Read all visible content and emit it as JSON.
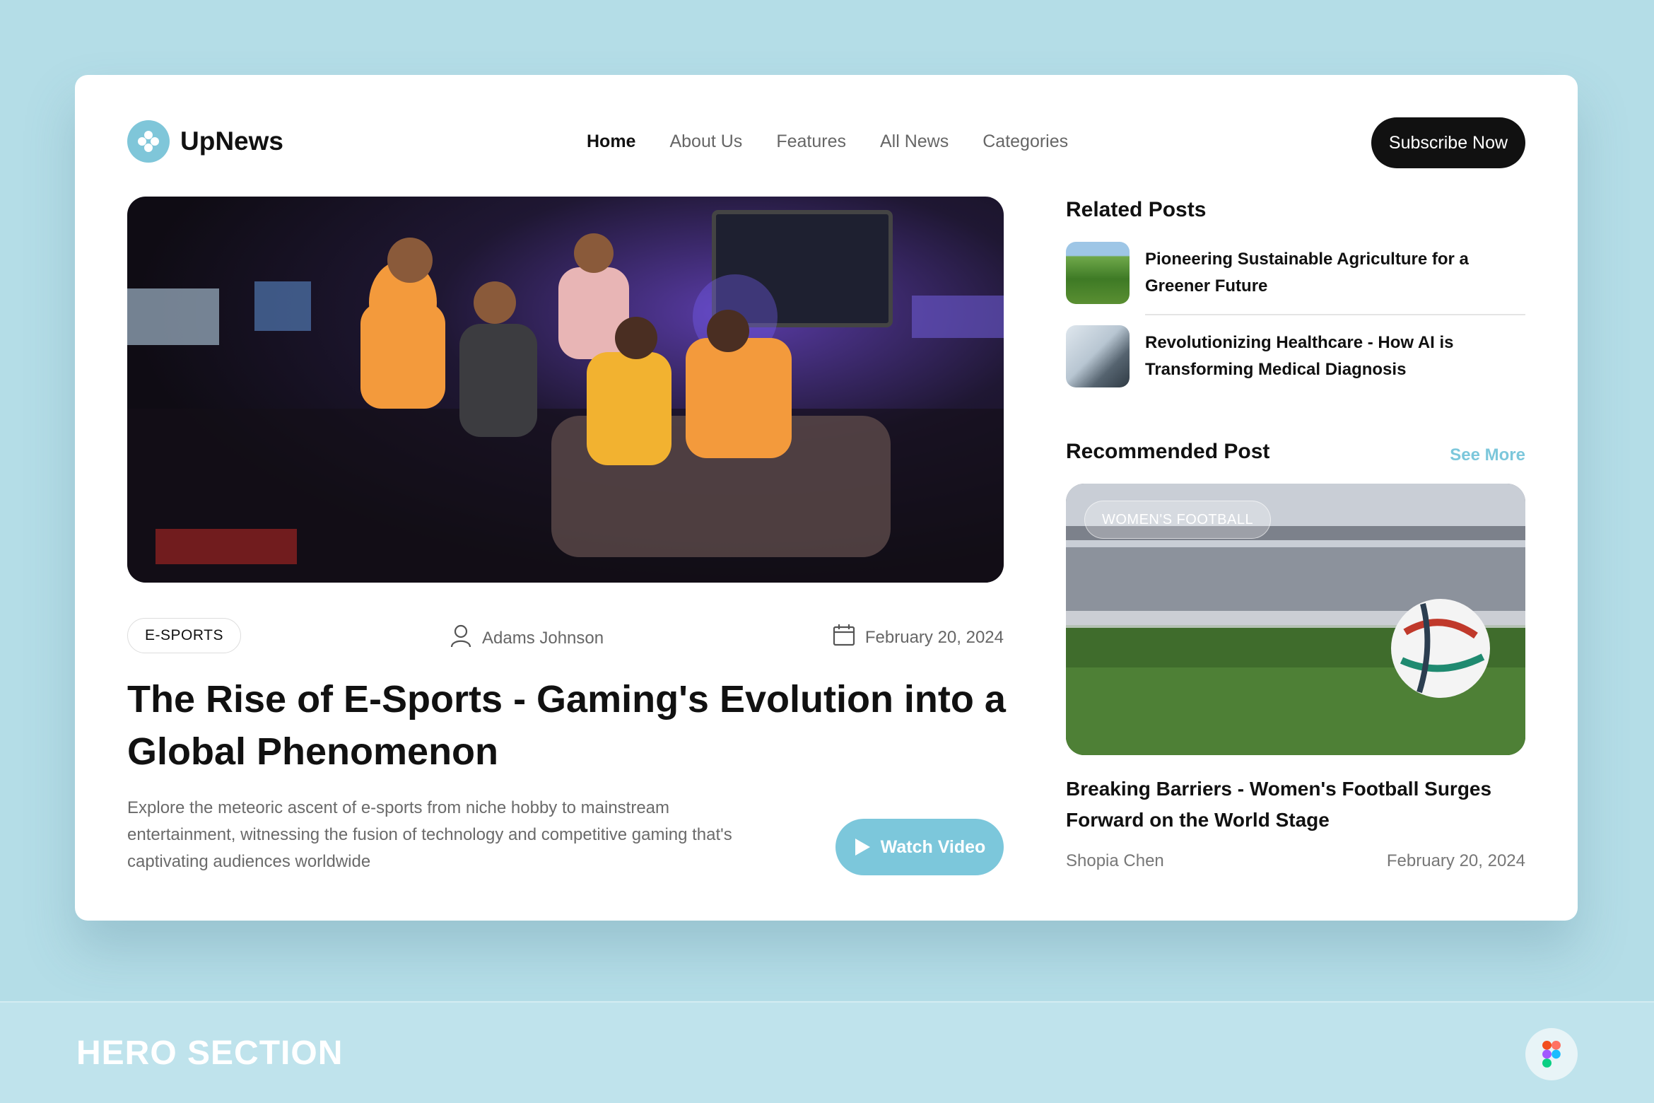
{
  "brand": {
    "name": "UpNews",
    "logo_icon": "flower-logo-icon",
    "accent": "#7cc7db"
  },
  "nav": {
    "items": [
      {
        "label": "Home",
        "active": true
      },
      {
        "label": "About Us"
      },
      {
        "label": "Features"
      },
      {
        "label": "All News"
      },
      {
        "label": "Categories"
      }
    ]
  },
  "header": {
    "subscribe_label": "Subscribe Now"
  },
  "hero": {
    "tag": "E-SPORTS",
    "author": "Adams Johnson",
    "date": "February 20, 2024",
    "headline": "The Rise of E-Sports - Gaming's Evolution into a Global Phenomenon",
    "excerpt": "Explore the meteoric ascent of e-sports from niche hobby to mainstream entertainment, witnessing the fusion of technology and competitive gaming that's captivating audiences worldwide",
    "watch_label": "Watch Video"
  },
  "related": {
    "title": "Related Posts",
    "items": [
      {
        "title": "Pioneering Sustainable Agriculture for a Greener Future"
      },
      {
        "title": "Revolutionizing Healthcare - How AI is Transforming Medical Diagnosis"
      }
    ]
  },
  "recommended": {
    "title": "Recommended Post",
    "see_more": "See More",
    "badge": "WOMEN'S FOOTBALL",
    "post_title": "Breaking Barriers - Women's Football Surges Forward on the World Stage",
    "author": "Shopia Chen",
    "date": "February 20, 2024"
  },
  "footer": {
    "label": "HERO SECTION",
    "icon": "figma-icon"
  }
}
